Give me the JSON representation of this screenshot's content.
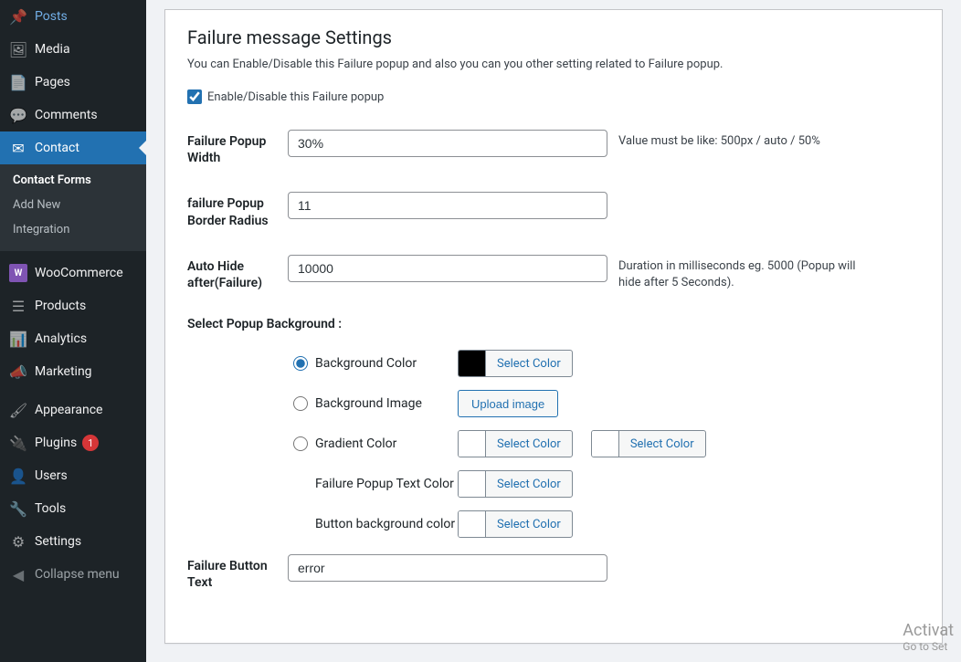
{
  "sidebar": {
    "items": [
      {
        "label": "Posts",
        "icon": "📌"
      },
      {
        "label": "Media",
        "icon": "🎞"
      },
      {
        "label": "Pages",
        "icon": "📄"
      },
      {
        "label": "Comments",
        "icon": "💬"
      },
      {
        "label": "Contact",
        "icon": "✉"
      }
    ],
    "submenu": [
      {
        "label": "Contact Forms"
      },
      {
        "label": "Add New"
      },
      {
        "label": "Integration"
      }
    ],
    "items2": [
      {
        "label": "WooCommerce",
        "icon": "W"
      },
      {
        "label": "Products",
        "icon": "📦"
      },
      {
        "label": "Analytics",
        "icon": "📊"
      },
      {
        "label": "Marketing",
        "icon": "📣"
      }
    ],
    "items3": [
      {
        "label": "Appearance",
        "icon": "🖌"
      },
      {
        "label": "Plugins",
        "icon": "🔌",
        "badge": "1"
      },
      {
        "label": "Users",
        "icon": "👤"
      },
      {
        "label": "Tools",
        "icon": "🔧"
      },
      {
        "label": "Settings",
        "icon": "⚙"
      }
    ],
    "collapse": "Collapse menu"
  },
  "section": {
    "title": "Failure message Settings",
    "desc": "You can Enable/Disable this Failure popup and also you can you other setting related to Failure popup.",
    "enable_label": "Enable/Disable this Failure popup"
  },
  "fields": {
    "width": {
      "label": "Failure Popup Width",
      "value": "30%",
      "hint": "Value must be like: 500px / auto / 50%"
    },
    "radius": {
      "label": "failure Popup Border Radius",
      "value": "11"
    },
    "autohide": {
      "label": "Auto Hide after(Failure)",
      "value": "10000",
      "hint": "Duration in milliseconds eg. 5000 (Popup will hide after 5 Seconds)."
    },
    "bg_title": "Select Popup Background :",
    "bg_color": {
      "label": "Background Color",
      "btn": "Select Color",
      "swatch": "#000000"
    },
    "bg_image": {
      "label": "Background Image",
      "btn": "Upload image"
    },
    "gradient": {
      "label": "Gradient Color",
      "btn": "Select Color"
    },
    "text_color": {
      "label": "Failure Popup Text Color",
      "btn": "Select Color"
    },
    "btn_bg": {
      "label": "Button background color",
      "btn": "Select Color"
    },
    "btn_text": {
      "label": "Failure Button Text",
      "value": "error"
    }
  },
  "watermark": {
    "l1": "Activat",
    "l2": "Go to Set"
  }
}
